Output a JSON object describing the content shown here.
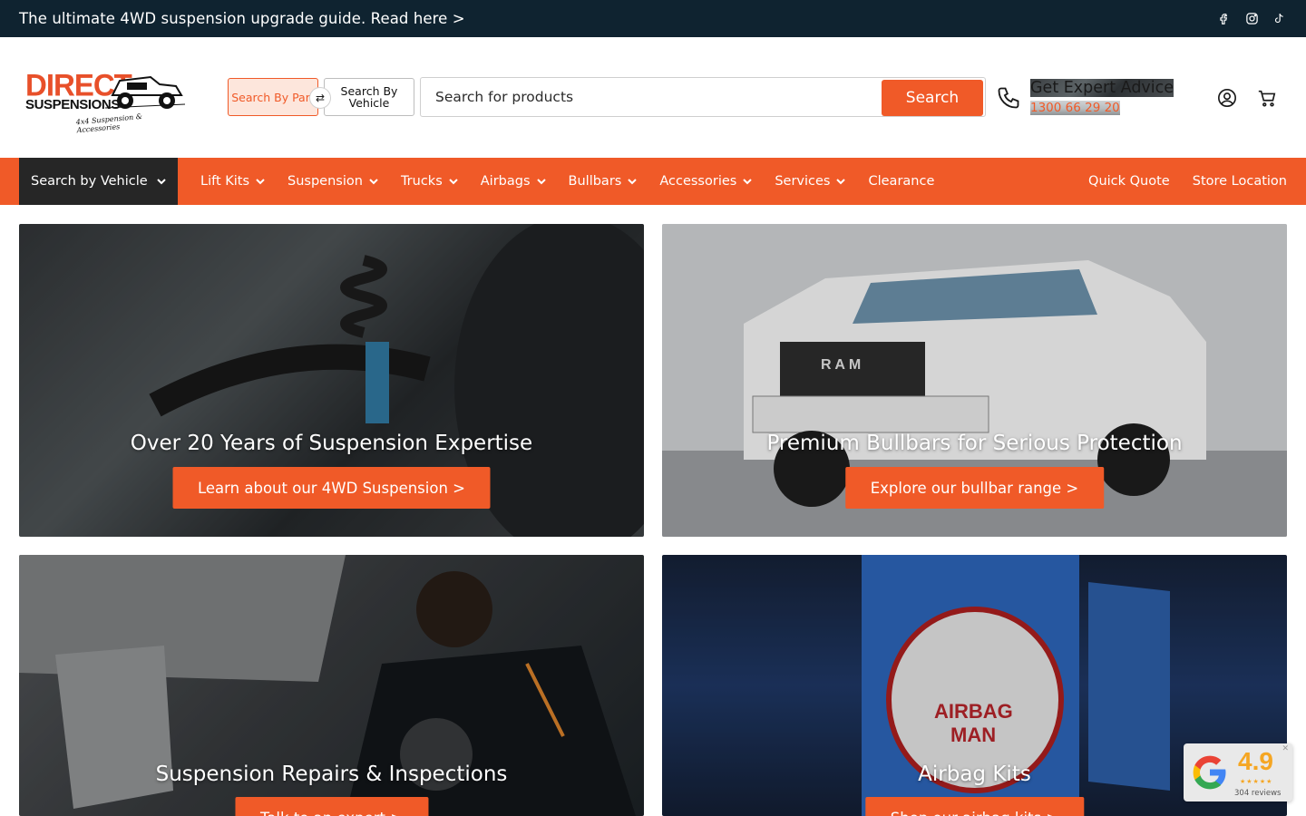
{
  "topbar": {
    "promo": "The ultimate 4WD suspension upgrade guide. Read here >",
    "socials": [
      "facebook-icon",
      "instagram-icon",
      "tiktok-icon"
    ]
  },
  "header": {
    "logo": {
      "line1": "DIRECT",
      "line2": "SUSPENSIONS",
      "tagline": "4x4 Suspension & Accessories"
    },
    "search_by_part": "Search By Part",
    "search_by_vehicle": "Search By Vehicle",
    "search_placeholder": "Search for products",
    "search_button": "Search",
    "advice_title": "Get Expert Advice",
    "advice_phone": "1300 66 29 20"
  },
  "nav": {
    "vehicle": "Search by Vehicle",
    "items": [
      "Lift Kits",
      "Suspension",
      "Trucks",
      "Airbags",
      "Bullbars",
      "Accessories",
      "Services",
      "Clearance"
    ],
    "right": [
      "Quick Quote",
      "Store Location"
    ]
  },
  "tiles": [
    {
      "title": "Over 20 Years of Suspension Expertise",
      "cta": "Learn about our 4WD Suspension >"
    },
    {
      "title": "Premium Bullbars for Serious Protection",
      "cta": "Explore our bullbar range >"
    },
    {
      "title": "Suspension Repairs & Inspections",
      "cta": "Talk to an expert >"
    },
    {
      "title": "Airbag Kits",
      "cta": "Shop our airbag kits >"
    }
  ],
  "review": {
    "score": "4.9",
    "stars": "★★★★★",
    "count": "304 reviews"
  },
  "colors": {
    "accent": "#f05a28",
    "topbar": "#0f2330",
    "nav_dark": "#262626",
    "star": "#f5a623"
  }
}
